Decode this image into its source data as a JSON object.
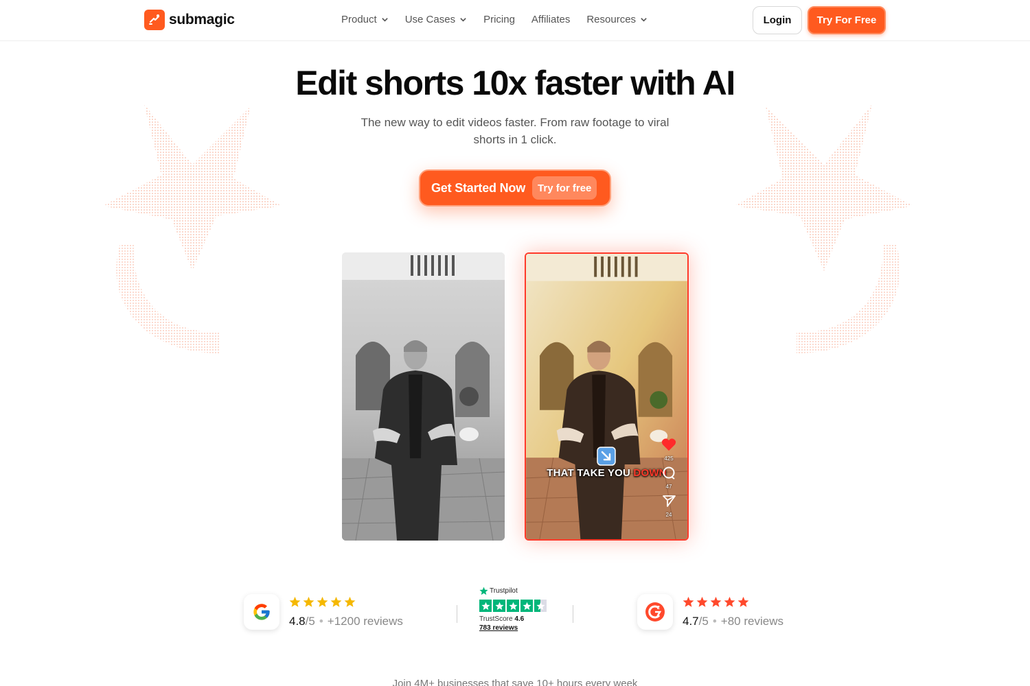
{
  "brand": {
    "name": "submagic",
    "accent": "#ff5a1f"
  },
  "nav": {
    "links": [
      {
        "label": "Product",
        "dropdown": true
      },
      {
        "label": "Use Cases",
        "dropdown": true
      },
      {
        "label": "Pricing",
        "dropdown": false
      },
      {
        "label": "Affiliates",
        "dropdown": false
      },
      {
        "label": "Resources",
        "dropdown": true
      }
    ],
    "login_label": "Login",
    "try_label": "Try For Free"
  },
  "hero": {
    "title": "Edit shorts 10x faster with AI",
    "subtitle": "The new way to edit videos faster. From raw footage to viral shorts in 1 click.",
    "cta_label": "Get Started Now",
    "cta_pill": "Try for free"
  },
  "video_right": {
    "caption_main": "THAT TAKE YOU ",
    "caption_highlight": "DOWN",
    "like_count": "425",
    "comment_count": "47",
    "share_count": "24"
  },
  "reviews": {
    "google": {
      "icon": "google-icon",
      "score": "4.8",
      "out_of": "/5",
      "count": "+1200 reviews",
      "stars": 5
    },
    "trustpilot": {
      "name": "Trustpilot",
      "score_label": "TrustScore",
      "score": "4.6",
      "count": "783 reviews",
      "stars": 4.5
    },
    "g2": {
      "icon": "g2-icon",
      "score": "4.7",
      "out_of": "/5",
      "count": "+80 reviews",
      "stars": 5
    }
  },
  "teaser": "Join 4M+ businesses that save 10+ hours every week"
}
